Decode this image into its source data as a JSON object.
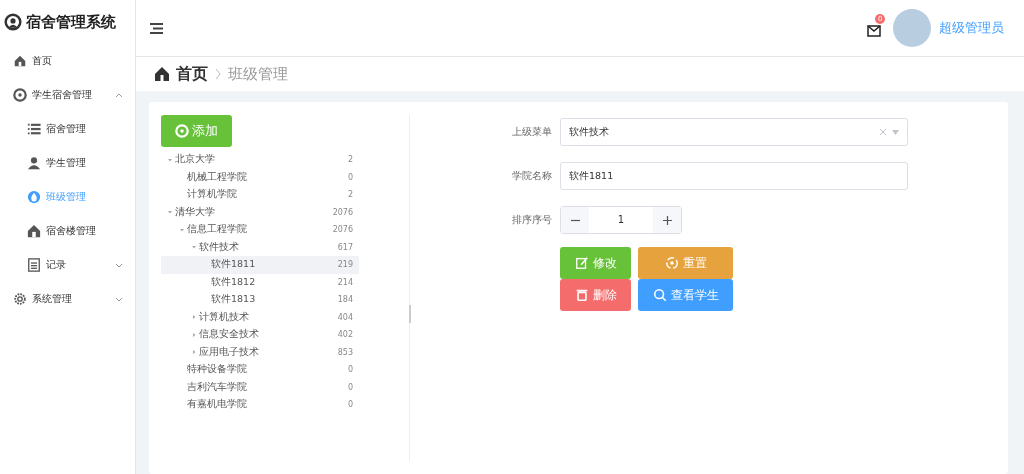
{
  "app": {
    "title": "宿舍管理系统"
  },
  "sidebar": {
    "items": [
      {
        "label": "首页",
        "kind": "home",
        "selected": false
      },
      {
        "label": "学生宿舍管理",
        "kind": "group",
        "expanded": true,
        "children": [
          {
            "label": "宿舍管理",
            "kind": "list",
            "selected": false
          },
          {
            "label": "学生管理",
            "kind": "person",
            "selected": false
          },
          {
            "label": "班级管理",
            "kind": "drop",
            "selected": true
          },
          {
            "label": "宿舍楼管理",
            "kind": "building",
            "selected": false
          },
          {
            "label": "记录",
            "kind": "record",
            "expanded": false
          }
        ]
      },
      {
        "label": "系统管理",
        "kind": "gear",
        "expanded": false
      }
    ]
  },
  "header": {
    "notification_count": "0",
    "user_name": "超级管理员"
  },
  "breadcrumb": [
    "首页",
    "班级管理"
  ],
  "add_button": "添加",
  "tree": [
    {
      "label": "北京大学",
      "count": "2",
      "expanded": true,
      "selected": false,
      "children": [
        {
          "label": "机械工程学院",
          "count": "0",
          "selected": false
        },
        {
          "label": "计算机学院",
          "count": "2",
          "selected": false
        }
      ]
    },
    {
      "label": "清华大学",
      "count": "2076",
      "expanded": true,
      "selected": false,
      "children": [
        {
          "label": "信息工程学院",
          "count": "2076",
          "expanded": true,
          "selected": false,
          "children": [
            {
              "label": "软件技术",
              "count": "617",
              "expanded": true,
              "selected": false,
              "children": [
                {
                  "label": "软件1811",
                  "count": "219",
                  "selected": true
                },
                {
                  "label": "软件1812",
                  "count": "214",
                  "selected": false
                },
                {
                  "label": "软件1813",
                  "count": "184",
                  "selected": false
                }
              ]
            },
            {
              "label": "计算机技术",
              "count": "404",
              "expanded": false,
              "selected": false
            },
            {
              "label": "信息安全技术",
              "count": "402",
              "expanded": false,
              "selected": false
            },
            {
              "label": "应用电子技术",
              "count": "853",
              "expanded": false,
              "selected": false
            }
          ]
        },
        {
          "label": "特种设备学院",
          "count": "0",
          "selected": false
        },
        {
          "label": "吉利汽车学院",
          "count": "0",
          "selected": false
        },
        {
          "label": "有嘉机电学院",
          "count": "0",
          "selected": false
        }
      ]
    }
  ],
  "form": {
    "parent_menu": {
      "label": "上级菜单",
      "value": "软件技术"
    },
    "college_name": {
      "label": "学院名称",
      "value": "软件1811"
    },
    "sort_order": {
      "label": "排序序号",
      "value": "1"
    },
    "buttons": [
      {
        "label": "修改",
        "kind": "edit"
      },
      {
        "label": "重置",
        "kind": "reset"
      },
      {
        "label": "删除",
        "kind": "delete"
      },
      {
        "label": "查看学生",
        "kind": "view"
      }
    ]
  }
}
